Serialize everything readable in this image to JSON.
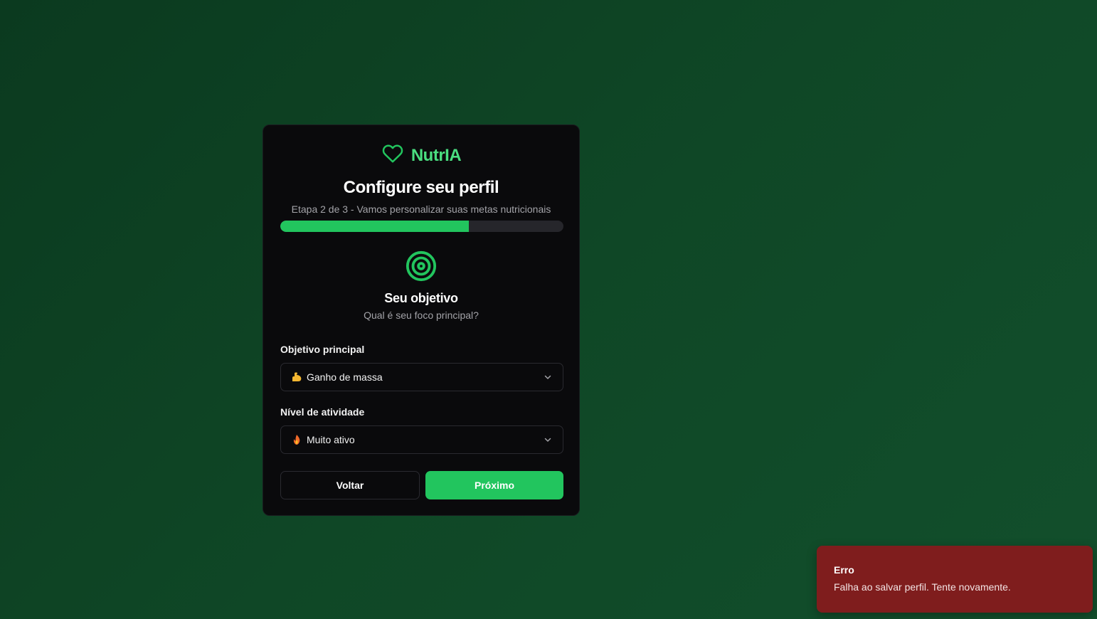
{
  "brand": {
    "name": "NutrIA",
    "icon": "heart-icon",
    "color": "#4ade80"
  },
  "header": {
    "title": "Configure seu perfil",
    "subtitle": "Etapa 2 de 3 - Vamos personalizar suas metas nutricionais"
  },
  "progress": {
    "step": 2,
    "total": 3,
    "fraction": 0.667,
    "fill_color": "#22c55e"
  },
  "section": {
    "icon": "target-icon",
    "title": "Seu objetivo",
    "subtitle": "Qual é seu foco principal?"
  },
  "form": {
    "goal": {
      "label": "Objetivo principal",
      "value": "Ganho de massa",
      "emoji": "flexed-biceps-icon"
    },
    "activity": {
      "label": "Nível de atividade",
      "value": "Muito ativo",
      "emoji": "fire-icon"
    }
  },
  "actions": {
    "back_label": "Voltar",
    "next_label": "Próximo"
  },
  "toast": {
    "title": "Erro",
    "message": "Falha ao salvar perfil. Tente novamente.",
    "color": "#7f1d1d"
  }
}
